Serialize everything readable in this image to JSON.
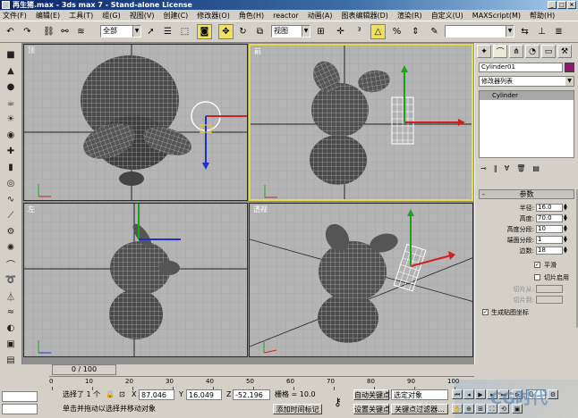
{
  "window": {
    "title": "再生猪.max - 3ds max 7 - Stand-alone License",
    "buttons": [
      "_",
      "□",
      "×"
    ]
  },
  "menu": [
    "文件(F)",
    "编辑(E)",
    "工具(T)",
    "组(G)",
    "视图(V)",
    "创建(C)",
    "修改器(O)",
    "角色(H)",
    "reactor",
    "动画(A)",
    "图表编辑器(D)",
    "渲染(R)",
    "自定义(U)",
    "MAXScript(M)",
    "帮助(H)"
  ],
  "toolbar": {
    "selection_filter": "全部",
    "ref_coord": "视图",
    "named_sel": ""
  },
  "viewports": {
    "top": "顶",
    "front": "前",
    "left": "左",
    "persp": "透视"
  },
  "cmd": {
    "object_name": "Cylinder01",
    "color": "#8a1a6e",
    "modifier_list": "修改器列表",
    "stack_item": "Cylinder",
    "rollout_title": "参数",
    "params": [
      {
        "label": "半径:",
        "value": "16.0"
      },
      {
        "label": "高度:",
        "value": "70.0"
      },
      {
        "label": "高度分段:",
        "value": "10"
      },
      {
        "label": "端面分段:",
        "value": "1"
      },
      {
        "label": "边数:",
        "value": "18"
      }
    ],
    "smooth": "平滑",
    "slice_on": "切片启用",
    "slice_from": "切片从:",
    "slice_to": "切片到:",
    "gen_map": "生成贴图坐标"
  },
  "timeline": {
    "slider": "0 / 100",
    "ticks": [
      "0",
      "10",
      "20",
      "30",
      "40",
      "50",
      "60",
      "70",
      "80",
      "90",
      "100"
    ]
  },
  "status": {
    "selected": "选择了 1 个",
    "x_label": "X",
    "x": "87.046",
    "y_label": "Y",
    "y": "16.049",
    "z_label": "Z",
    "z": "-52.196",
    "grid": "栅格 = 10.0",
    "prompt": "单击并拖动以选择并移动对象",
    "add_time_tag": "添加时间标记",
    "auto_key": "自动关键点",
    "set_key": "设置关键点",
    "key_filter": "关键点过滤器...",
    "sel_object": "选定对象",
    "frame": "0"
  },
  "watermark": "CG时代"
}
